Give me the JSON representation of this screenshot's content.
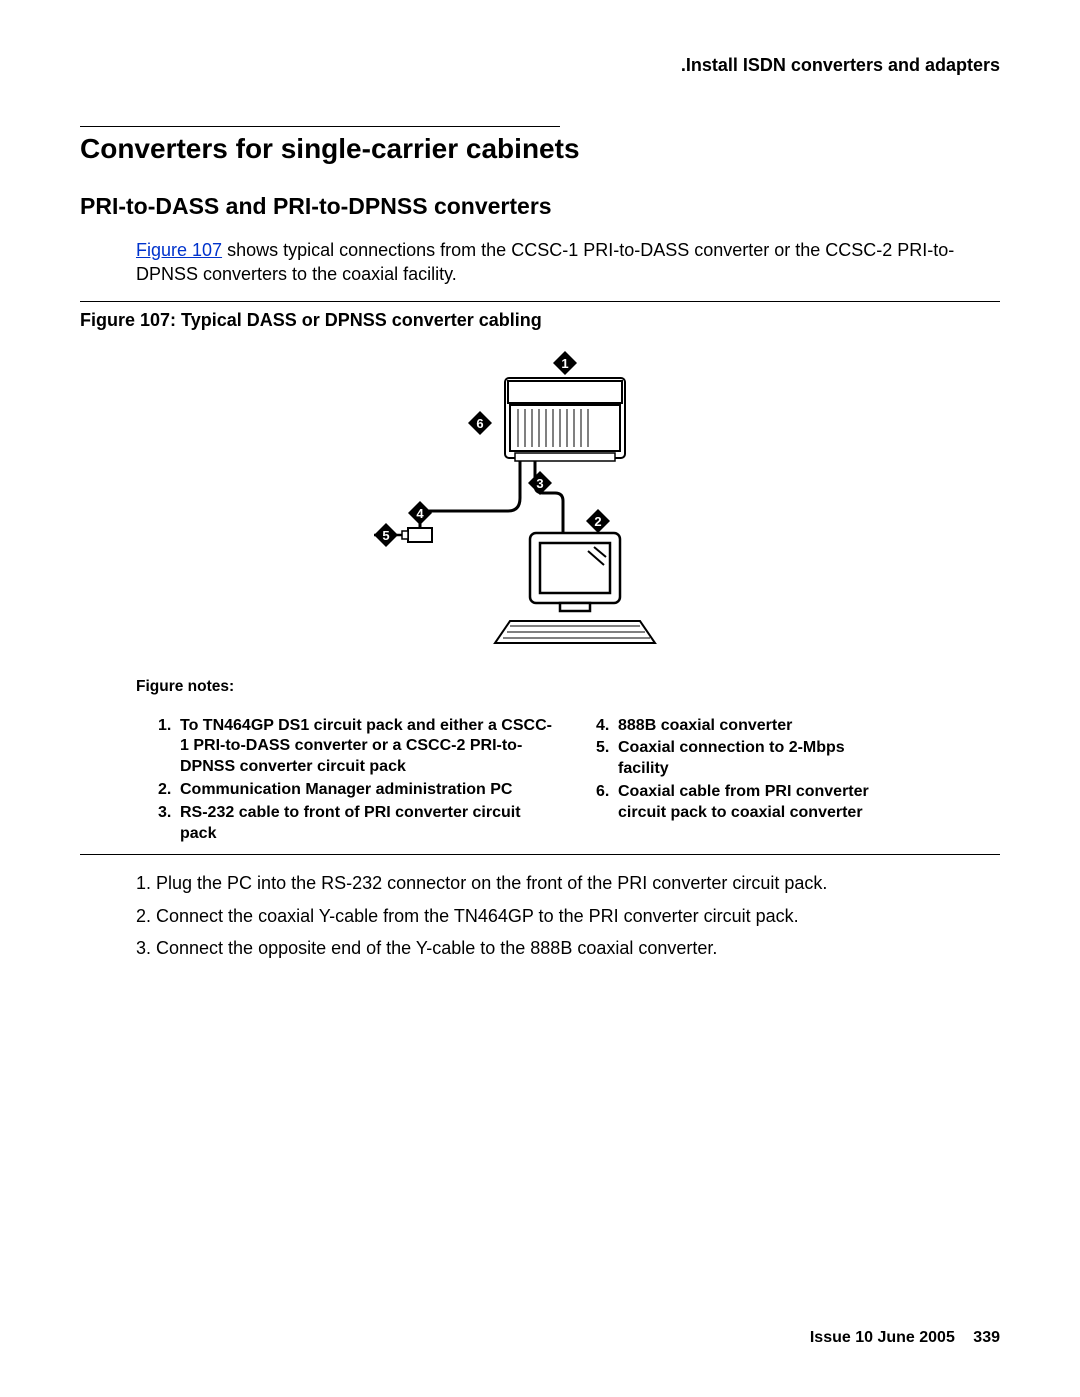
{
  "header": ".Install ISDN converters and adapters",
  "h1": "Converters for single-carrier cabinets",
  "h2": "PRI-to-DASS and PRI-to-DPNSS converters",
  "intro_link": "Figure 107",
  "intro_rest": " shows typical connections from the CCSC-1 PRI-to-DASS converter or the CCSC-2 PRI-to-DPNSS converters to the coaxial facility.",
  "fig_title": "Figure 107: Typical DASS or DPNSS converter cabling",
  "fig_notes_label": "Figure notes:",
  "notes_left": [
    {
      "n": "1.",
      "t": "To TN464GP DS1 circuit pack and either a CSCC-1 PRI-to-DASS converter or a CSCC-2 PRI-to-DPNSS converter circuit pack"
    },
    {
      "n": "2.",
      "t": "Communication Manager administration PC"
    },
    {
      "n": "3.",
      "t": "RS-232 cable to front of PRI converter circuit pack"
    }
  ],
  "notes_right": [
    {
      "n": "4.",
      "t": "888B coaxial converter"
    },
    {
      "n": "5.",
      "t": "Coaxial connection to 2-Mbps facility"
    },
    {
      "n": "6.",
      "t": "Coaxial cable from PRI converter circuit pack to coaxial converter"
    }
  ],
  "steps": [
    {
      "n": "1.",
      "t": "Plug the PC into the RS-232 connector on the front of the PRI converter circuit pack."
    },
    {
      "n": "2.",
      "t": "Connect the coaxial Y-cable from the TN464GP to the PRI converter circuit pack."
    },
    {
      "n": "3.",
      "t": "Connect the opposite end of the Y-cable to the 888B coaxial converter."
    }
  ],
  "footer": {
    "issue": "Issue 10   June 2005",
    "page": "339"
  },
  "callouts": {
    "c1": "1",
    "c2": "2",
    "c3": "3",
    "c4": "4",
    "c5": "5",
    "c6": "6"
  }
}
